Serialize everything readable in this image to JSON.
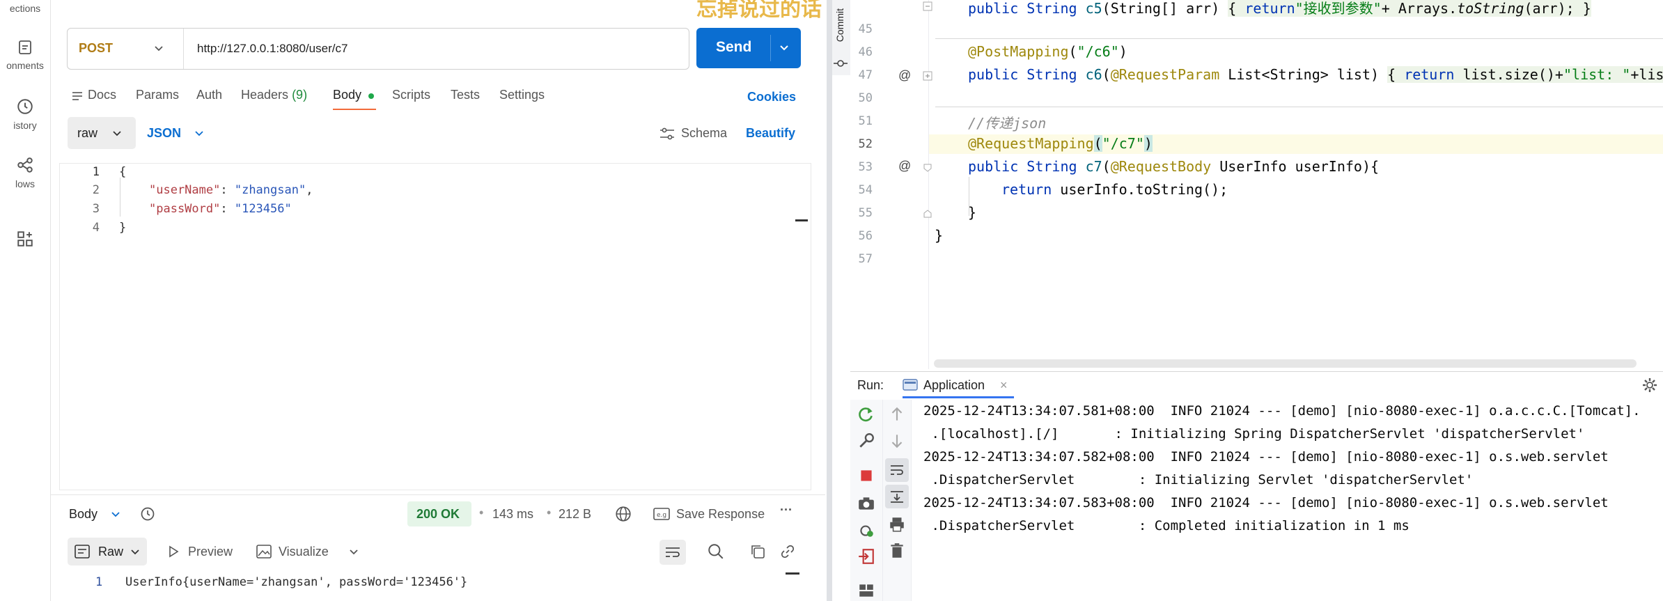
{
  "postman": {
    "sidebar": {
      "items": [
        {
          "label": "ections",
          "icon": "collections-icon"
        },
        {
          "label": "onments",
          "icon": "environments-icon"
        },
        {
          "label": "istory",
          "icon": "history-icon"
        },
        {
          "label": "lows",
          "icon": "flows-icon"
        },
        {
          "label": "",
          "icon": "more-apps-icon"
        }
      ]
    },
    "request": {
      "method": "POST",
      "url": "http://127.0.0.1:8080/user/c7",
      "send_label": "Send"
    },
    "tabs": [
      {
        "label": "Docs"
      },
      {
        "label": "Params"
      },
      {
        "label": "Auth"
      },
      {
        "label": "Headers",
        "count": "(9)"
      },
      {
        "label": "Body",
        "active": true
      },
      {
        "label": "Scripts"
      },
      {
        "label": "Tests"
      },
      {
        "label": "Settings"
      }
    ],
    "cookies_label": "Cookies",
    "body_mode": "raw",
    "body_format": "JSON",
    "schema_label": "Schema",
    "beautify_label": "Beautify",
    "body_lines": [
      {
        "n": "1",
        "text": "{"
      },
      {
        "n": "2",
        "key": "\"userName\"",
        "sep": ": ",
        "val": "\"zhangsan\"",
        "tail": ","
      },
      {
        "n": "3",
        "key": "\"passWord\"",
        "sep": ": ",
        "val": "\"123456\"",
        "tail": ""
      },
      {
        "n": "4",
        "text": "}"
      }
    ],
    "response": {
      "section_label": "Body",
      "status": "200 OK",
      "time": "143 ms",
      "size": "212 B",
      "save_label": "Save Response",
      "view_mode": "Raw",
      "preview_label": "Preview",
      "visualize_label": "Visualize",
      "line_no": "1",
      "body": "UserInfo{userName='zhangsan', passWord='123456'}"
    },
    "banner_fragment": "忘掉说过的话",
    "accent": "#0b6ed1",
    "method_color": "#b07c16"
  },
  "idea": {
    "commit_label": "Commit",
    "lines": [
      {
        "n": "45"
      },
      {
        "n": "46"
      },
      {
        "n": "47"
      },
      {
        "n": "50"
      },
      {
        "n": "51"
      },
      {
        "n": "52"
      },
      {
        "n": "53"
      },
      {
        "n": "54"
      },
      {
        "n": "55"
      },
      {
        "n": "56"
      },
      {
        "n": "57"
      }
    ],
    "code": {
      "l45a": "public String ",
      "l45m": "c5",
      "l45b": "(String[] arr) ",
      "l45c": "{ ",
      "l45d": "return",
      "l45e": "\"接收到参数\"",
      "l45f": "+ Arrays.",
      "l45g": "toString",
      "l45h": "(arr); ",
      "l45i": "}",
      "l46a": "@PostMapping",
      "l46b": "(",
      "l46c": "\"/c6\"",
      "l46d": ")",
      "l47a": "public String ",
      "l47m": "c6",
      "l47b": "(",
      "l47c": "@RequestParam",
      "l47d": " List<String> list) ",
      "l47e": "{ ",
      "l47f": "return",
      "l47g": " list.size()+",
      "l47h": "\"list: \"",
      "l47i": "+list",
      "l51": "//传递json",
      "l52a": "@RequestMapping",
      "l52b": "(",
      "l52c": "\"/c7\"",
      "l52d": ")",
      "l53a": "public String ",
      "l53m": "c7",
      "l53b": "(",
      "l53c": "@RequestBody",
      "l53d": " UserInfo userInfo){",
      "l54a": "return",
      "l54b": " userInfo.toString();",
      "l55": "}",
      "l56": "}"
    },
    "run": {
      "label": "Run:",
      "tab_label": "Application",
      "console": [
        "2025-12-24T13:34:07.581+08:00  INFO 21024 --- [demo] [nio-8080-exec-1] o.a.c.c.C.[Tomcat].",
        " .[localhost].[/]       : Initializing Spring DispatcherServlet 'dispatcherServlet'",
        "2025-12-24T13:34:07.582+08:00  INFO 21024 --- [demo] [nio-8080-exec-1] o.s.web.servlet",
        " .DispatcherServlet        : Initializing Servlet 'dispatcherServlet'",
        "2025-12-24T13:34:07.583+08:00  INFO 21024 --- [demo] [nio-8080-exec-1] o.s.web.servlet",
        " .DispatcherServlet        : Completed initialization in 1 ms"
      ]
    }
  }
}
